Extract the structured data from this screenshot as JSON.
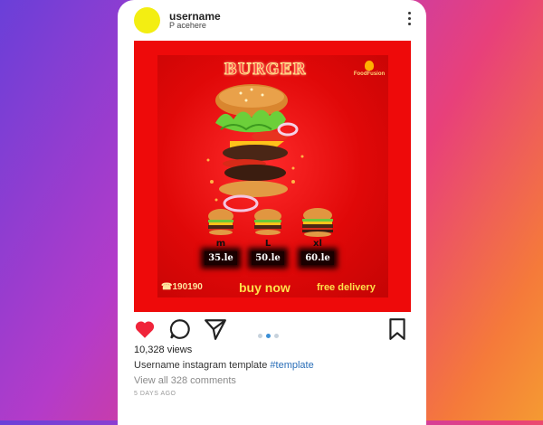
{
  "header": {
    "username": "username",
    "location": "P acehere",
    "more_icon": "more-vertical-icon"
  },
  "post_image": {
    "title": "BURGER",
    "logo_text": "FoodFusion",
    "sizes": [
      {
        "label": "m",
        "price": "35.le"
      },
      {
        "label": "L",
        "price": "50.le"
      },
      {
        "label": "xl",
        "price": "60.le"
      }
    ],
    "phone": "☎190190",
    "buy_text": "buy now",
    "delivery_text": "free delivery",
    "colors": {
      "background": "#ee0a0a",
      "accent": "#ffe04a"
    }
  },
  "actions": {
    "like_icon": "heart-icon",
    "comment_icon": "comment-icon",
    "share_icon": "send-icon",
    "save_icon": "bookmark-icon",
    "carousel_index": 2,
    "carousel_count": 3
  },
  "footer": {
    "views": "10,328 views",
    "caption_user": "Username",
    "caption_text": " instagram template ",
    "caption_tag": "#template",
    "comments_link": "View all 328 comments",
    "time": "5 DAYS AGO"
  }
}
